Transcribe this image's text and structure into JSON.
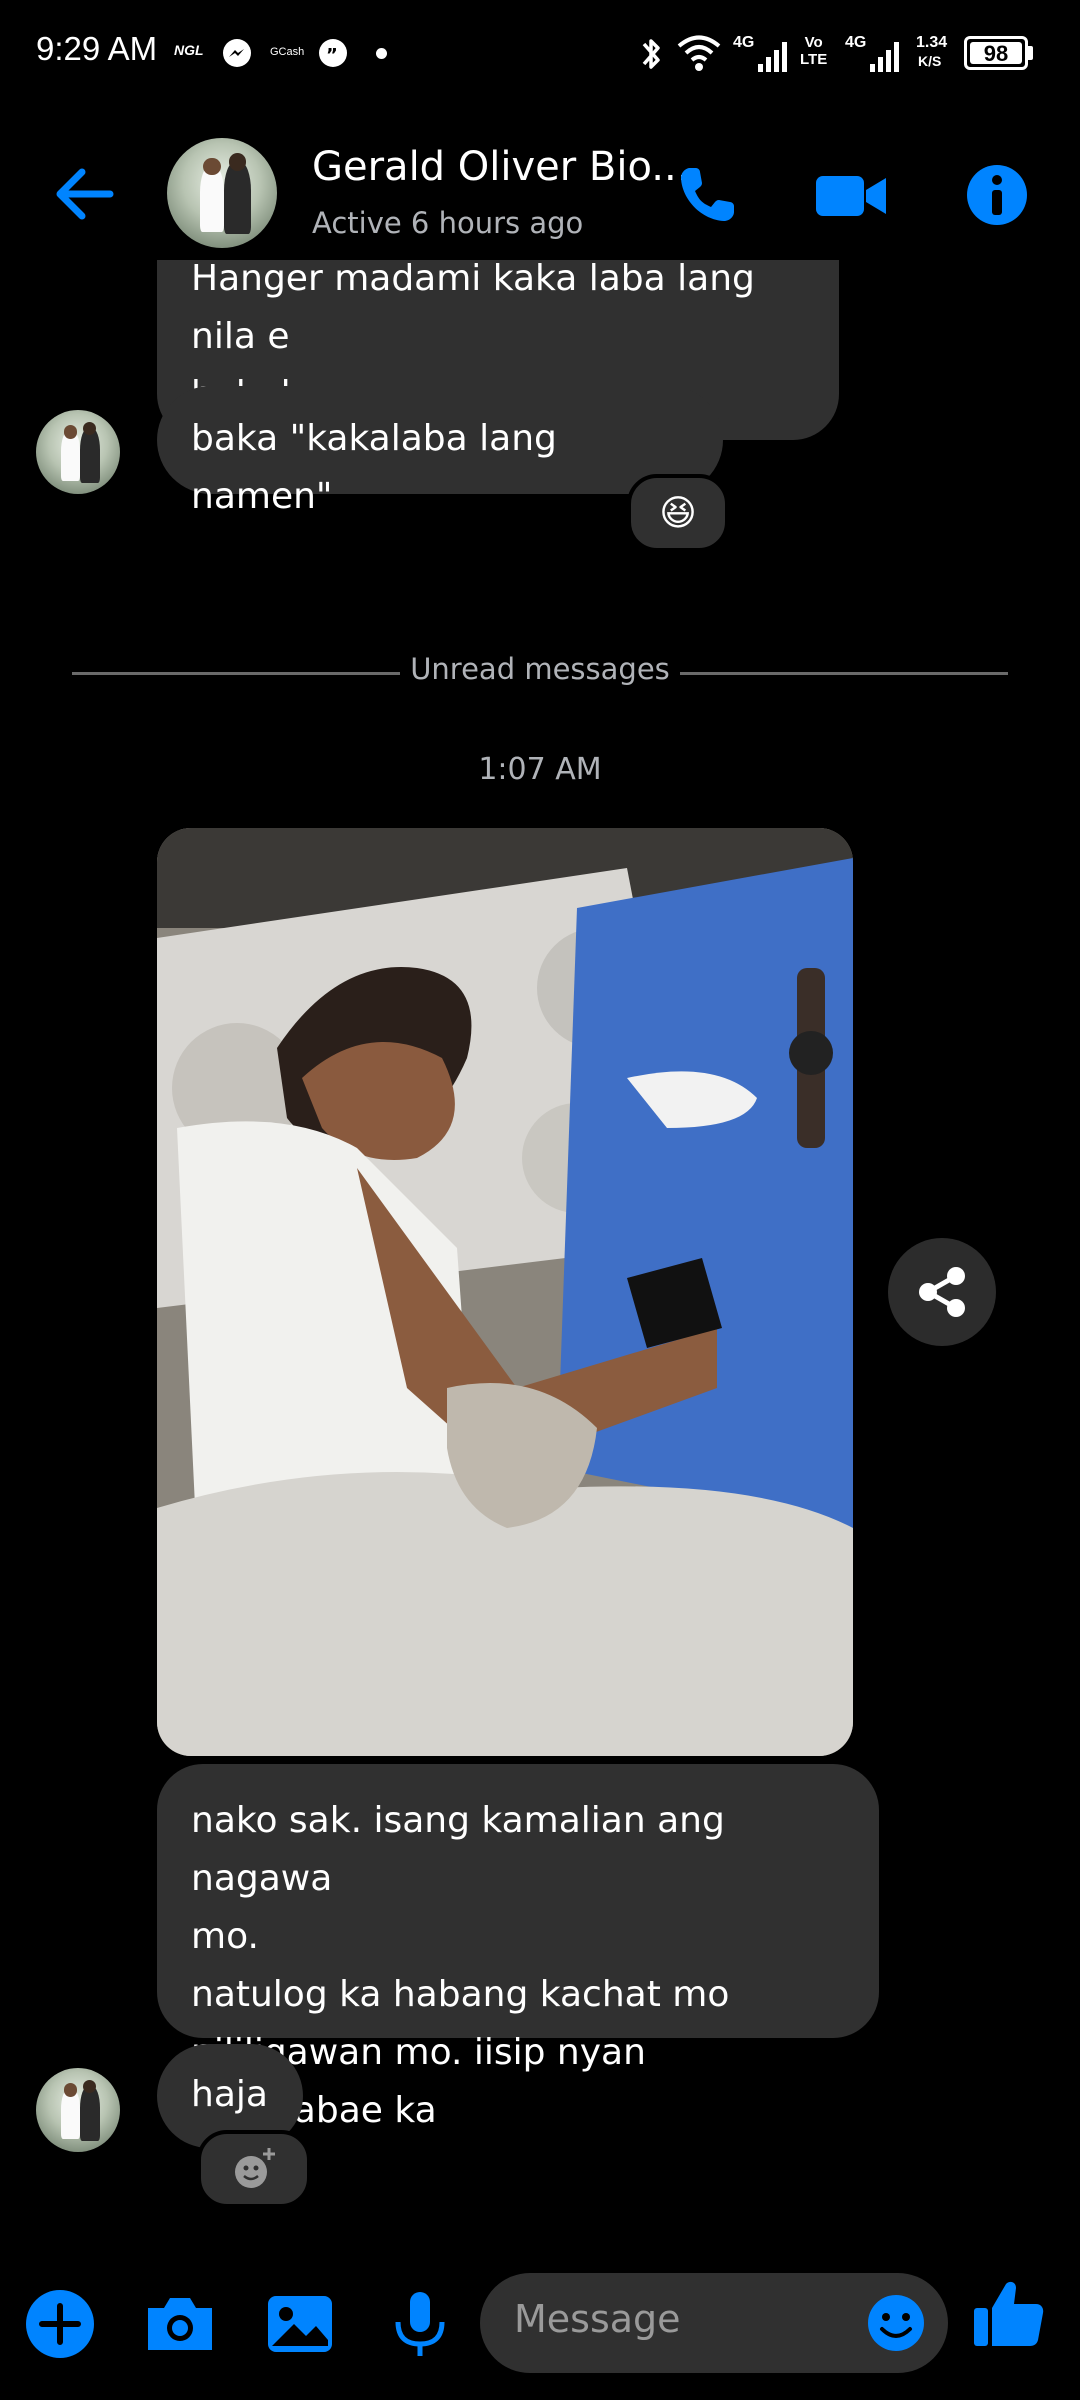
{
  "status_bar": {
    "time": "9:29 AM",
    "app_badges": [
      "NGL",
      "GCash"
    ],
    "network_1": "4G",
    "volte": "Vo\nLTE",
    "network_2": "4G",
    "speed_value": "1.34",
    "speed_unit": "K/S",
    "battery": "98"
  },
  "header": {
    "contact_name": "Gerald Oliver Bio...",
    "active_status": "Active 6 hours ago"
  },
  "messages": {
    "prev_bubble_text": "Hanger madami kaka laba lang nila e\nhahaha",
    "msg1_text": "baka \"kakalaba lang namen\"",
    "msg1_reaction": "😆",
    "unread_label": "Unread messages",
    "timestamp": "1:07 AM",
    "msg3_text": "nako sak. isang kamalian ang nagawa\nmo.\nnatulog ka habang kachat mo\nnililigawan mo. iisip nyan nambabae ka",
    "msg4_text": "haja"
  },
  "composer": {
    "placeholder": "Message"
  },
  "colors": {
    "accent": "#0084ff",
    "bubble": "#303030",
    "background": "#000000",
    "secondary_text": "#b0b3b8"
  },
  "icons": {
    "back": "arrow-left-icon",
    "call": "phone-icon",
    "video": "video-camera-icon",
    "info": "info-icon",
    "share": "share-icon",
    "add_reaction": "add-reaction-icon",
    "plus": "plus-circle-icon",
    "camera": "camera-icon",
    "gallery": "image-icon",
    "mic": "microphone-icon",
    "emoji": "emoji-icon",
    "like": "thumbs-up-icon"
  }
}
